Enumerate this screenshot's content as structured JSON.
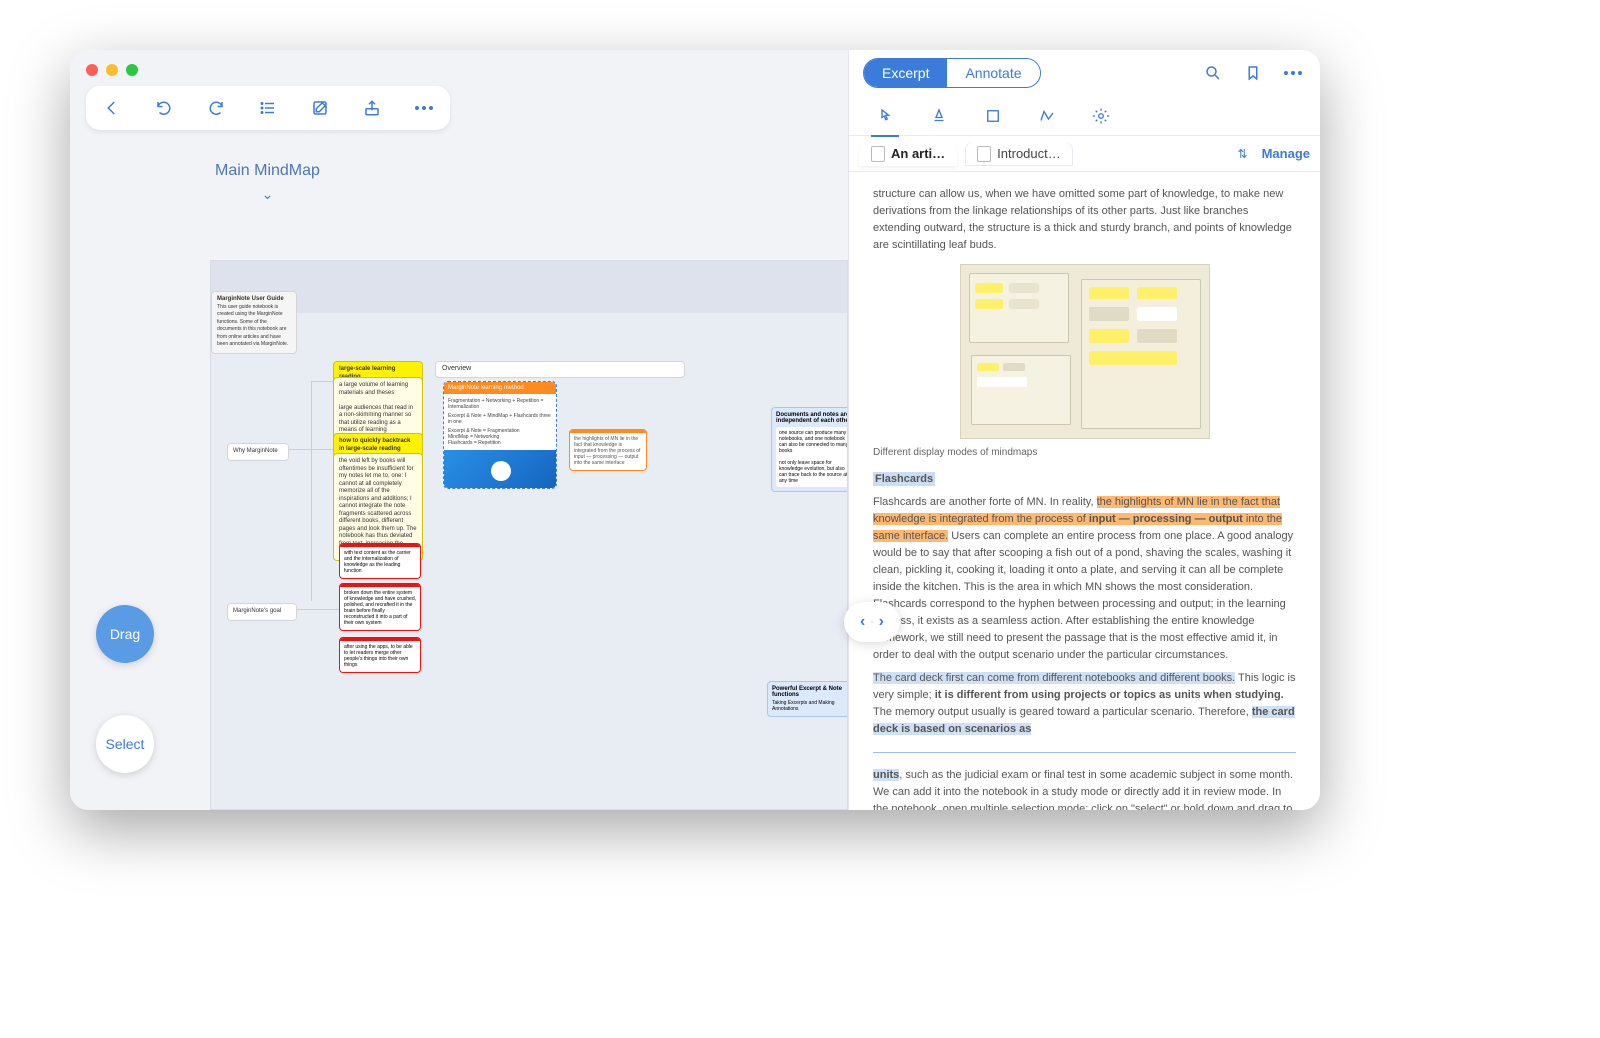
{
  "main": {
    "title": "Main MindMap"
  },
  "toolbar": {
    "drag": "Drag",
    "select": "Select"
  },
  "canvas": {
    "root": {
      "title": "MarginNote User Guide",
      "body": "This user guide notebook is created using the MarginNote functions. Some of the documents in this notebook are from online articles and have been annotated via MarginNote."
    },
    "why": "Why MarginNote",
    "goal": "MarginNote's goal",
    "ls_title": "large-scale learning reading",
    "ls_body": "a large volume of learning materials and theses\n\nlarge audiences that read in a non-skimming manner so that utilize reading as a means of learning",
    "back_title": "how to quickly backtrack in large-scale reading",
    "back_body": "the void left by books will oftentimes be insufficient for my notes let me to, one: I cannot at all completely memorize all of the inspirations and additions; I cannot integrate the note fragments scattered across different books, different pages and look them up. The notebook has thus deviated from text, increasing the difficulty of looking back",
    "overview": "Overview",
    "orange": {
      "title": "MarginNote learning method",
      "l1": "Fragmentation + Networking + Repetition = Internalization",
      "l2": "Excerpt & Note + MindMap + Flashcards three in one",
      "l3": "Excerpt & Note = Fragmentation",
      "l4": "MindMap = Networking",
      "l5": "Flashcards = Repetition"
    },
    "call": "the highlights of MN lie in the fact that knowledge is integrated from the process of input — processing — output into the same interface",
    "red1": "with text content as the carrier and the internalization of knowledge as the leading function",
    "red2": "broken down the entire system of knowledge and have crushed, polished, and recrafted it in the brain before finally reconstructed it into a part of their own system",
    "red3": "after using the apps, to be able to let readers merge other people's things into their own things",
    "doc_title": "Documents and notes are independent of each other",
    "doc_body": "one source can produce many notebooks, and one notebook can also be connected to many books\n\nnot only leave space for knowledge evolution, but also can trace back to the source at any time",
    "powerful": "Powerful Excerpt & Note functions",
    "powerful_sub": "Taking Excerpts and Making Annotations"
  },
  "right": {
    "seg": {
      "excerpt": "Excerpt",
      "annotate": "Annotate"
    },
    "tab1": "An arti…",
    "tab2": "Introduct…",
    "manage": "Manage",
    "intro": "structure can allow us, when we have omitted some part of knowledge, to make new derivations from the linkage relationships of its other parts. Just like branches extending outward, the structure is a thick and sturdy branch, and points of knowledge are scintillating leaf buds.",
    "caption": "Different display modes of mindmaps",
    "flash_head": "Flashcards",
    "p1a": "Flashcards are another forte of MN. In reality, ",
    "p1h": "the highlights of MN lie in the fact that knowledge is integrated from the process of ",
    "p1b": "input — processing — output",
    "p1h2": " into the same interface.",
    "p1c": " Users can complete an entire process from one place. A good analogy would be to say that after scooping a fish out of a pond, shaving the scales, washing it clean, pickling it, cooking it, loading it onto a plate, and serving it can all be complete inside the kitchen. This is the area in which MN shows the most consideration. Flashcards correspond to the hyphen between processing and output; in the learning process, it exists as a seamless action. After establishing the entire knowledge framework, we still need to present the passage that is the most effective amid it, in order to deal with the output scenario under the particular circumstances.",
    "p2a": "The card deck first can come from different notebooks and different books.",
    "p2b": " This logic is very simple; ",
    "p2c": "it is different from using projects or topics as units when studying.",
    "p2d": " The memory output usually is geared toward a particular scenario. Therefore, ",
    "p2e": "the card deck is based on scenarios as",
    "p3a": "units",
    "p3b": ", such as the judicial exam or final test in some academic subject in some month. We can add it into the notebook in a study mode or directly add it in review mode. In the notebook, open multiple selection mode: click on \"select\" or hold down and drag to open the frame selection mode (in reality, it includes the multiple selection of the frame selection). You can add cards in"
  }
}
